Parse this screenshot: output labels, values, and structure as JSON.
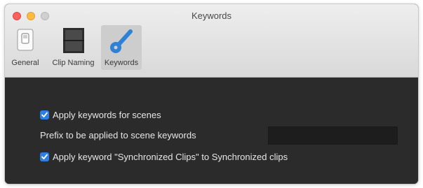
{
  "window": {
    "title": "Keywords"
  },
  "toolbar": {
    "tabs": [
      {
        "label": "General",
        "icon": "general-switch-icon",
        "active": false
      },
      {
        "label": "Clip Naming",
        "icon": "clip-naming-icon",
        "active": false
      },
      {
        "label": "Keywords",
        "icon": "keywords-key-icon",
        "active": true
      }
    ]
  },
  "settings": {
    "apply_keywords_for_scenes": {
      "label": "Apply keywords for scenes",
      "checked": true
    },
    "prefix": {
      "label": "Prefix to be applied to scene keywords",
      "value": "",
      "placeholder": ""
    },
    "apply_sync_keyword": {
      "label": "Apply keyword \"Synchronized Clips\" to Synchronized clips",
      "checked": true
    }
  },
  "colors": {
    "accent": "#2f7fe0",
    "content_bg": "#2b2b2b",
    "toolbar_bg": "#e4e4e4",
    "key_icon": "#2d82d6"
  }
}
